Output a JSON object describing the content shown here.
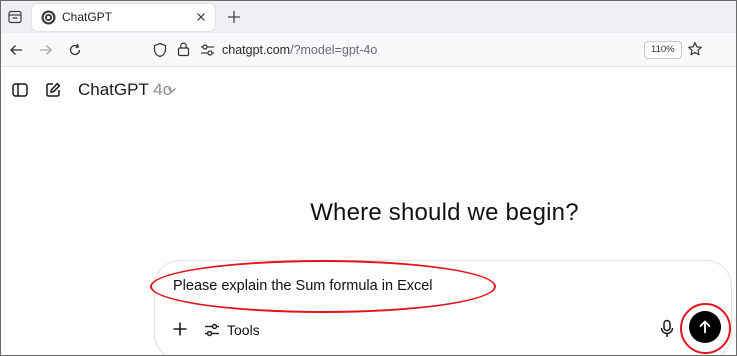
{
  "browser": {
    "tab": {
      "title": "ChatGPT"
    },
    "url": {
      "host": "chatgpt.com",
      "path": "/?model=gpt-4o"
    },
    "zoom": "110%"
  },
  "app": {
    "model_name": "ChatGPT",
    "model_version": "4o",
    "headline": "Where should we begin?"
  },
  "composer": {
    "prompt": "Please explain the Sum formula in Excel",
    "tools_label": "Tools"
  },
  "colors": {
    "annotation": "#e3141b",
    "send_button": "#000000"
  },
  "icons": [
    "tab-list-icon",
    "chatgpt-favicon-icon",
    "close-icon",
    "plus-icon",
    "back-arrow-icon",
    "forward-arrow-icon",
    "reload-icon",
    "shield-icon",
    "lock-icon",
    "permissions-icon",
    "star-icon",
    "sidebar-toggle-icon",
    "new-chat-icon",
    "chevron-down-icon",
    "attach-plus-icon",
    "tools-sliders-icon",
    "microphone-icon",
    "send-arrow-up-icon"
  ]
}
